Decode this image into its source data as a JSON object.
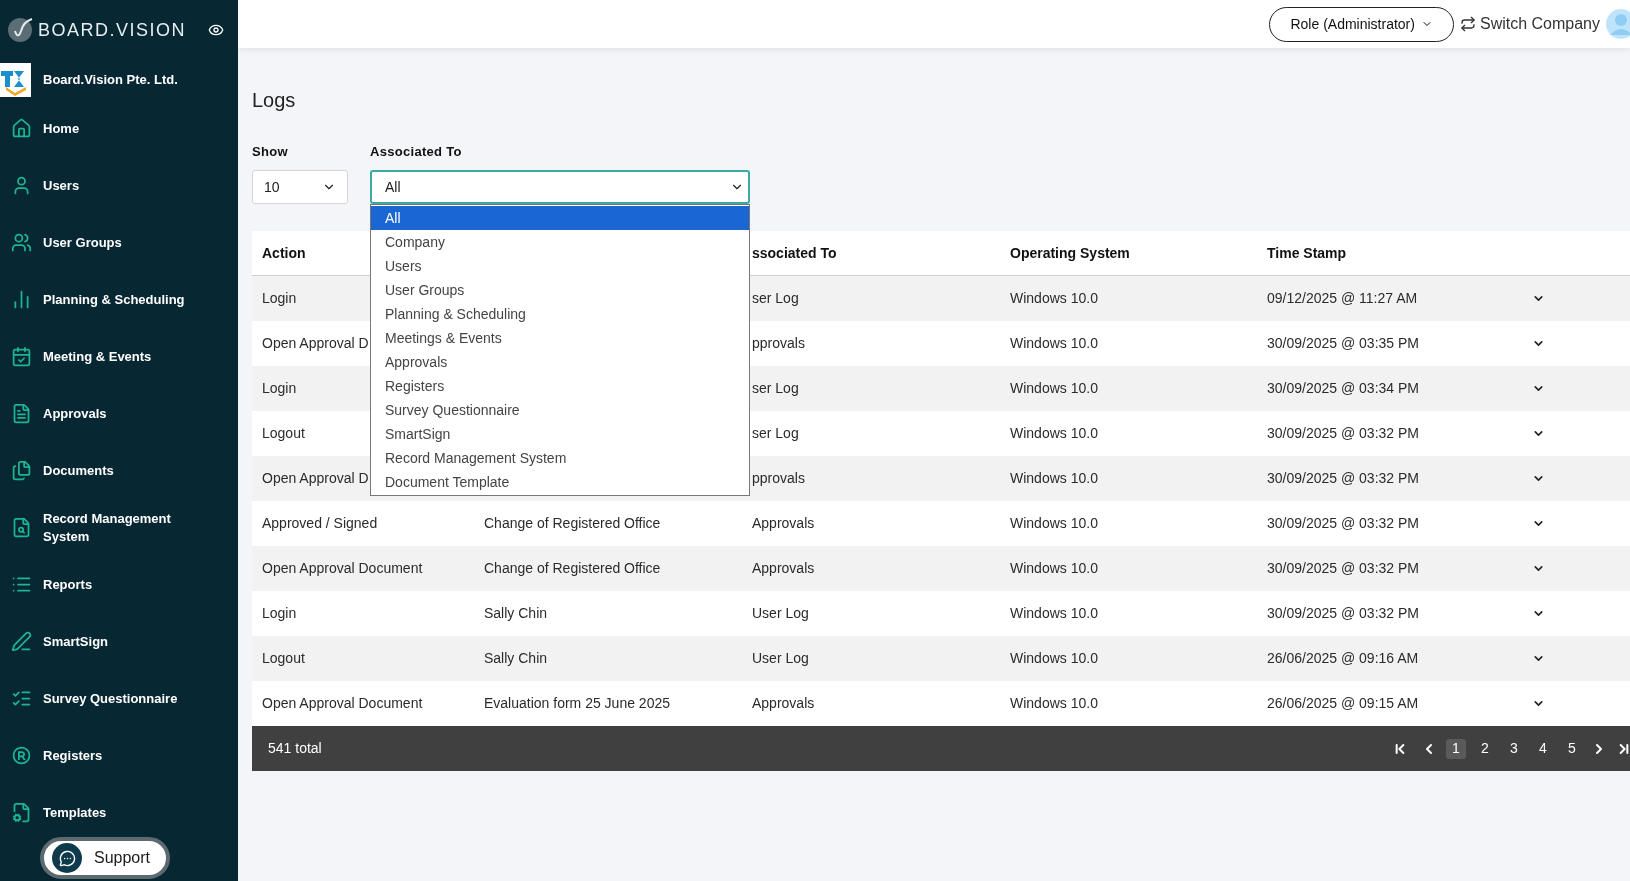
{
  "sidebar": {
    "brand": "BOARD.VISION",
    "company": "Board.Vision Pte. Ltd.",
    "items": [
      {
        "label": "Home"
      },
      {
        "label": "Users"
      },
      {
        "label": "User Groups"
      },
      {
        "label": "Planning & Scheduling"
      },
      {
        "label": "Meeting & Events"
      },
      {
        "label": "Approvals"
      },
      {
        "label": "Documents"
      },
      {
        "label": "Record Management System"
      },
      {
        "label": "Reports"
      },
      {
        "label": "SmartSign"
      },
      {
        "label": "Survey Questionnaire"
      },
      {
        "label": "Registers"
      },
      {
        "label": "Templates"
      }
    ],
    "support": "Support"
  },
  "topbar": {
    "role": "Role (Administrator)",
    "switch_company": "Switch Company"
  },
  "page_title": "Logs",
  "filters": {
    "show": {
      "label": "Show",
      "value": "10"
    },
    "associated_to": {
      "label": "Associated To",
      "value": "All",
      "options": [
        {
          "label": "All",
          "selected": true
        },
        {
          "label": "Company",
          "selected": false
        },
        {
          "label": "Users",
          "selected": false
        },
        {
          "label": "User Groups",
          "selected": false
        },
        {
          "label": "Planning & Scheduling",
          "selected": false
        },
        {
          "label": "Meetings & Events",
          "selected": false
        },
        {
          "label": "Approvals",
          "selected": false
        },
        {
          "label": "Registers",
          "selected": false
        },
        {
          "label": "Survey Questionnaire",
          "selected": false
        },
        {
          "label": "SmartSign",
          "selected": false
        },
        {
          "label": "Record Management System",
          "selected": false
        },
        {
          "label": "Document Template",
          "selected": false
        }
      ]
    }
  },
  "table": {
    "columns": {
      "action": "Action",
      "associated_to": "ssociated To",
      "operating_system": "Operating System",
      "time_stamp": "Time Stamp"
    },
    "rows": [
      {
        "action": "Login",
        "associated_to": "ser Log",
        "operating_system": "Windows 10.0",
        "time_stamp": "09/12/2025 @ 11:27 AM"
      },
      {
        "action": "Open Approval D",
        "associated_to": "pprovals",
        "operating_system": "Windows 10.0",
        "time_stamp": "30/09/2025 @ 03:35 PM"
      },
      {
        "action": "Login",
        "associated_to": "ser Log",
        "operating_system": "Windows 10.0",
        "time_stamp": "30/09/2025 @ 03:34 PM"
      },
      {
        "action": "Logout",
        "associated_to": "ser Log",
        "operating_system": "Windows 10.0",
        "time_stamp": "30/09/2025 @ 03:32 PM"
      },
      {
        "action": "Open Approval D",
        "associated_to": "pprovals",
        "operating_system": "Windows 10.0",
        "time_stamp": "30/09/2025 @ 03:32 PM"
      },
      {
        "action": "Approved / Signed",
        "column_2": "Change of Registered Office",
        "associated_to": "Approvals",
        "operating_system": "Windows 10.0",
        "time_stamp": "30/09/2025 @ 03:32 PM"
      },
      {
        "action": "Open Approval Document",
        "column_2": "Change of Registered Office",
        "associated_to": "Approvals",
        "operating_system": "Windows 10.0",
        "time_stamp": "30/09/2025 @ 03:32 PM"
      },
      {
        "action": "Login",
        "column_2": "Sally Chin",
        "associated_to": "User Log",
        "operating_system": "Windows 10.0",
        "time_stamp": "30/09/2025 @ 03:32 PM"
      },
      {
        "action": "Logout",
        "column_2": "Sally Chin",
        "associated_to": "User Log",
        "operating_system": "Windows 10.0",
        "time_stamp": "26/06/2025 @ 09:16 AM"
      },
      {
        "action": "Open Approval Document",
        "column_2": "Evaluation form 25 June 2025",
        "associated_to": "Approvals",
        "operating_system": "Windows 10.0",
        "time_stamp": "26/06/2025 @ 09:15 AM"
      }
    ],
    "total": "541 total",
    "pages": [
      {
        "label": "1",
        "selected": true
      },
      {
        "label": "2",
        "selected": false
      },
      {
        "label": "3",
        "selected": false
      },
      {
        "label": "4",
        "selected": false
      },
      {
        "label": "5",
        "selected": false
      }
    ]
  }
}
